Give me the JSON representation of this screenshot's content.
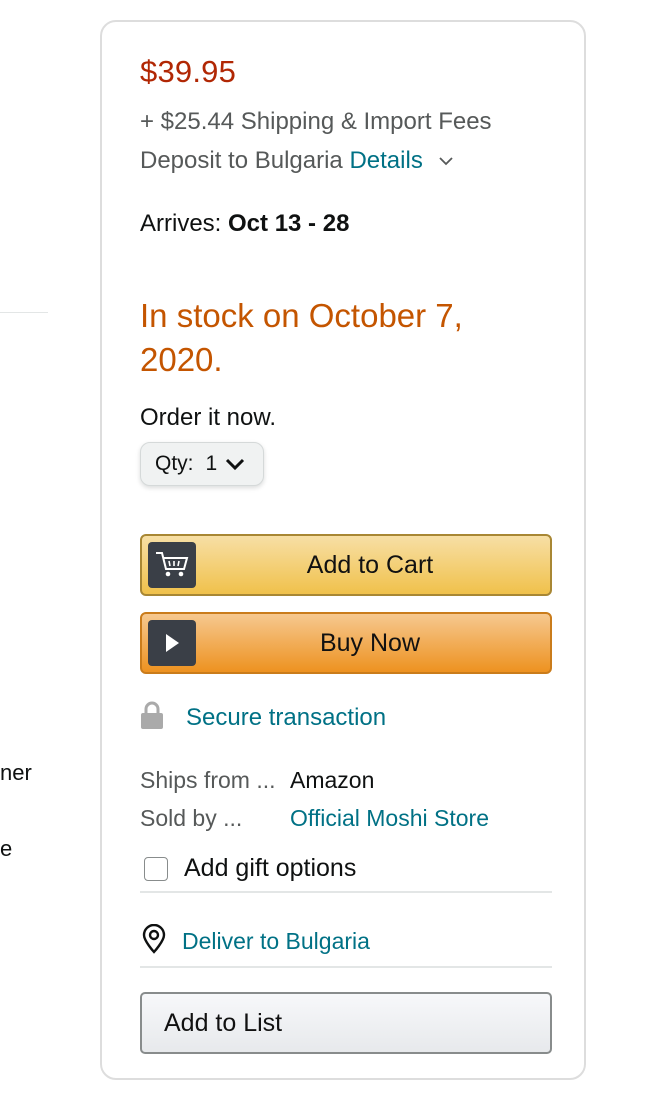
{
  "left_fragments": [
    "ner",
    "e"
  ],
  "buybox": {
    "price": "$39.95",
    "shipping": "+ $25.44 Shipping & Import Fees",
    "deposit_text": "Deposit to Bulgaria",
    "details_link": "Details",
    "arrives_label": "Arrives:",
    "arrives_dates": "Oct 13 - 28",
    "in_stock": "In stock on October 7, 2020.",
    "order_now": "Order it now.",
    "qty_label": "Qty:",
    "qty_value": "1",
    "add_to_cart": "Add to Cart",
    "buy_now": "Buy Now",
    "secure_transaction": "Secure transaction",
    "ships_from_label": "Ships from ...",
    "ships_from_value": "Amazon",
    "sold_by_label": "Sold by ...",
    "sold_by_value": "Official Moshi Store",
    "gift_options": "Add gift options",
    "deliver_to": "Deliver to Bulgaria",
    "add_to_list": "Add to List"
  },
  "colors": {
    "price": "#b12704",
    "in_stock": "#c45500",
    "link": "#007185",
    "cart_button": "#f0c14b",
    "buy_button": "#ed9220"
  },
  "icons": {
    "details": "chevron-down-icon",
    "qty": "chevron-down-icon",
    "cart": "cart-icon",
    "buy": "play-icon",
    "secure": "lock-icon",
    "deliver": "location-pin-icon"
  }
}
